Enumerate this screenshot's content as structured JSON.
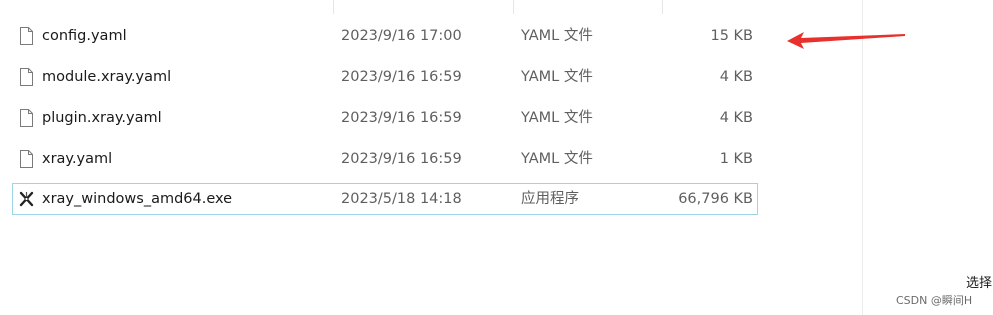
{
  "files": [
    {
      "name": "config.yaml",
      "date": "2023/9/16 17:00",
      "type": "YAML 文件",
      "size": "15 KB",
      "icon": "document-icon"
    },
    {
      "name": "module.xray.yaml",
      "date": "2023/9/16 16:59",
      "type": "YAML 文件",
      "size": "4 KB",
      "icon": "document-icon"
    },
    {
      "name": "plugin.xray.yaml",
      "date": "2023/9/16 16:59",
      "type": "YAML 文件",
      "size": "4 KB",
      "icon": "document-icon"
    },
    {
      "name": "xray.yaml",
      "date": "2023/9/16 16:59",
      "type": "YAML 文件",
      "size": "1 KB",
      "icon": "document-icon"
    },
    {
      "name": "xray_windows_amd64.exe",
      "date": "2023/5/18 14:18",
      "type": "应用程序",
      "size": "66,796 KB",
      "icon": "xray-app-icon",
      "selected": true
    }
  ],
  "annotation": {
    "icon": "red-arrow-icon",
    "color": "#e8312c"
  },
  "corner_label": "选择",
  "watermark": "CSDN @瞬间H"
}
